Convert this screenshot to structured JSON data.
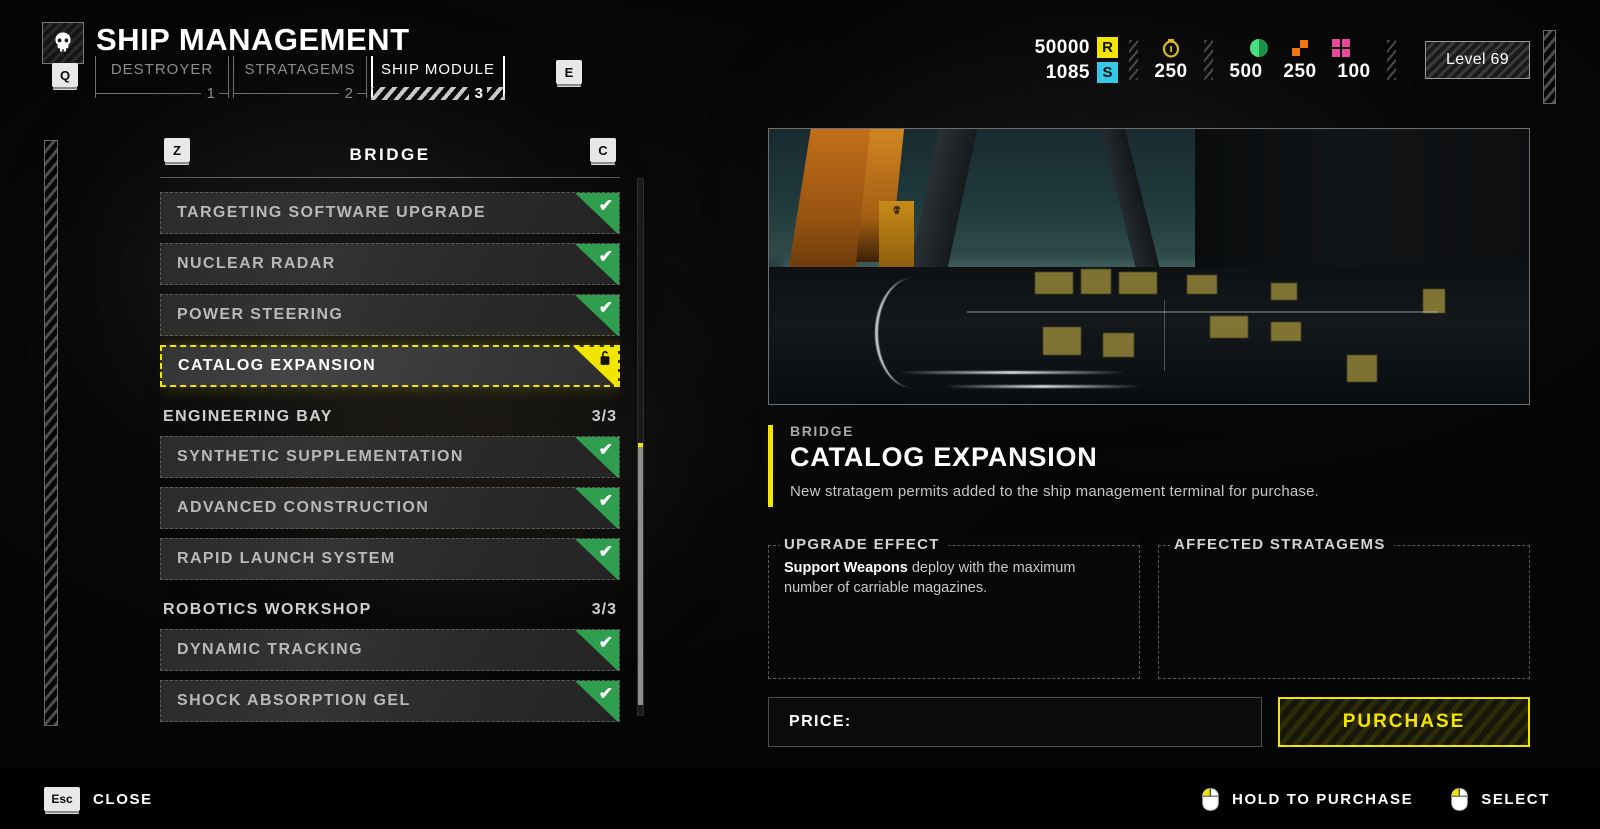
{
  "header": {
    "title": "SHIP MANAGEMENT",
    "logo_icon": "skull-icon",
    "prev_key": "Q",
    "next_key": "E",
    "tabs": [
      {
        "label": "DESTROYER",
        "number": "1",
        "active": false
      },
      {
        "label": "STRATAGEMS",
        "number": "2",
        "active": false
      },
      {
        "label": "SHIP MODULE",
        "number": "3",
        "active": true
      }
    ]
  },
  "resources": {
    "requisition": {
      "value": "50000",
      "chip": "R",
      "chip_color": "#f2e500"
    },
    "medals": {
      "value": "1085",
      "chip": "S",
      "chip_color": "#37c8e8"
    },
    "super_credits": {
      "value": "250",
      "icon": "super-credit-icon",
      "color": "#d9b728"
    },
    "samples": [
      {
        "value": "500",
        "icon": "common-sample-icon",
        "color": "#3fbf6a"
      },
      {
        "value": "250",
        "icon": "rare-sample-icon",
        "color": "#f07616"
      },
      {
        "value": "100",
        "icon": "super-sample-icon",
        "color": "#e8479a"
      }
    ],
    "level": "Level 69"
  },
  "list": {
    "prev_key": "Z",
    "next_key": "C",
    "title": "BRIDGE",
    "sections": [
      {
        "name": null,
        "count": null,
        "items": [
          {
            "label": "TARGETING SOFTWARE UPGRADE",
            "state": "owned",
            "badge_icon": "check-icon"
          },
          {
            "label": "NUCLEAR RADAR",
            "state": "owned",
            "badge_icon": "check-icon"
          },
          {
            "label": "POWER STEERING",
            "state": "owned",
            "badge_icon": "check-icon"
          },
          {
            "label": "CATALOG EXPANSION",
            "state": "selected",
            "badge_icon": "open-lock-icon"
          }
        ]
      },
      {
        "name": "ENGINEERING BAY",
        "count": "3/3",
        "items": [
          {
            "label": "SYNTHETIC SUPPLEMENTATION",
            "state": "owned",
            "badge_icon": "check-icon"
          },
          {
            "label": "ADVANCED CONSTRUCTION",
            "state": "owned",
            "badge_icon": "check-icon"
          },
          {
            "label": "RAPID LAUNCH SYSTEM",
            "state": "owned",
            "badge_icon": "check-icon"
          }
        ]
      },
      {
        "name": "ROBOTICS WORKSHOP",
        "count": "3/3",
        "items": [
          {
            "label": "DYNAMIC TRACKING",
            "state": "owned",
            "badge_icon": "check-icon"
          },
          {
            "label": "SHOCK ABSORPTION GEL",
            "state": "owned",
            "badge_icon": "check-icon"
          }
        ]
      }
    ]
  },
  "detail": {
    "preview_alt": "bridge-interior-preview",
    "category": "BRIDGE",
    "name": "CATALOG EXPANSION",
    "description": "New stratagem permits added to the ship management terminal for purchase.",
    "effect_heading": "UPGRADE EFFECT",
    "effect_bold": "Support Weapons",
    "effect_rest": " deploy with the maximum number of carriable magazines.",
    "affected_heading": "AFFECTED STRATAGEMS",
    "price_label": "PRICE:",
    "price_value": "",
    "purchase_label": "PURCHASE",
    "accent_color": "#f2e500"
  },
  "footer": {
    "close_key": "Esc",
    "close_label": "CLOSE",
    "hints": [
      {
        "icon": "mouse-left-click-icon",
        "label": "HOLD TO PURCHASE"
      },
      {
        "icon": "mouse-left-click-icon",
        "label": "SELECT"
      }
    ]
  }
}
